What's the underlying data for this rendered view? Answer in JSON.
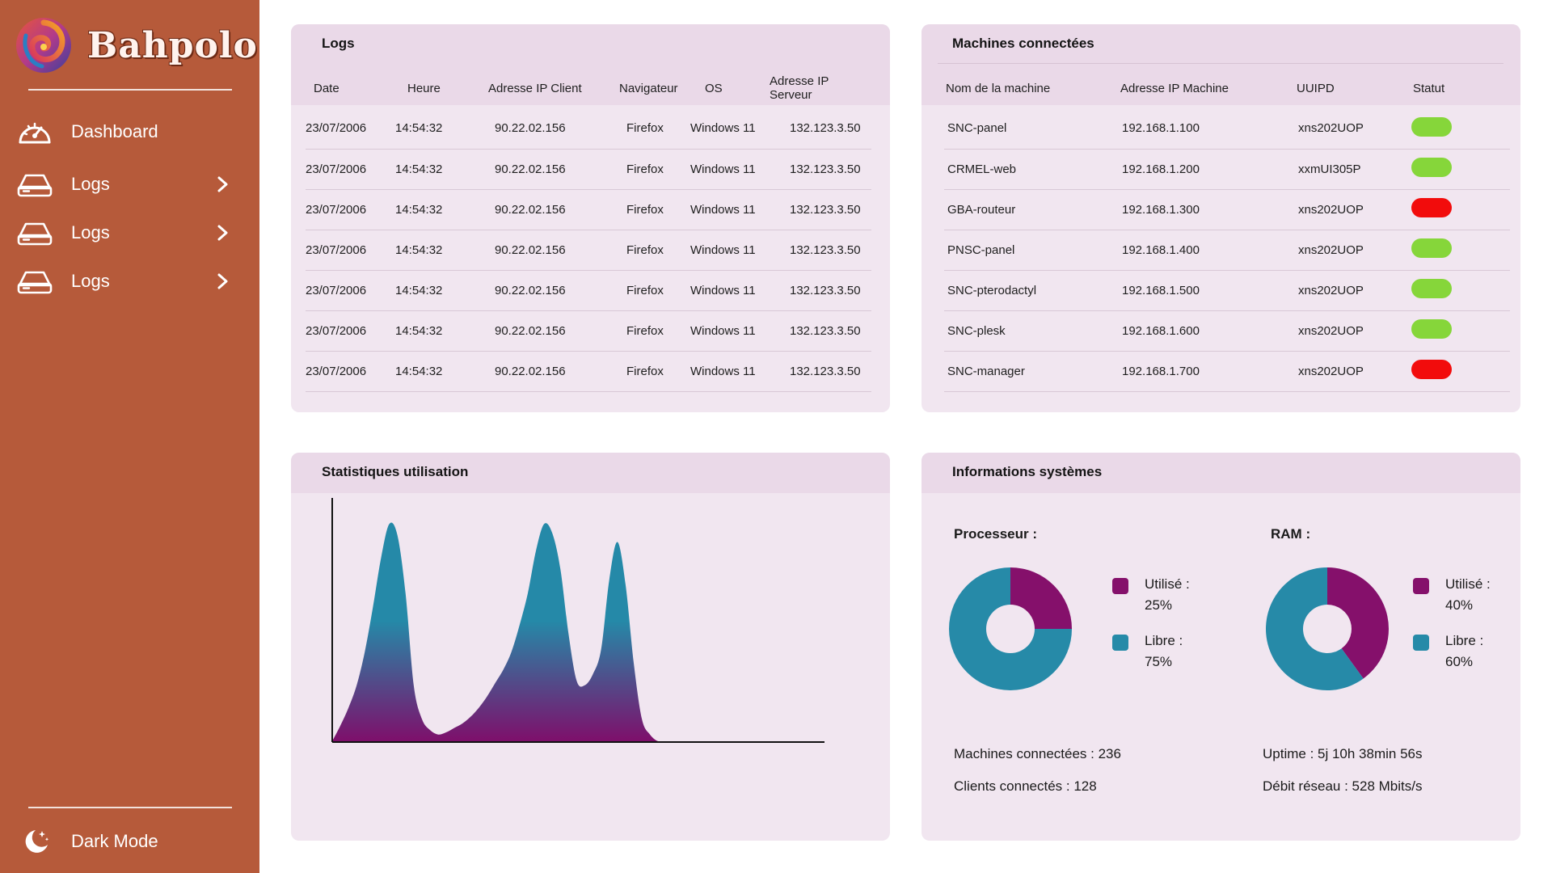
{
  "brand": {
    "name": "Bahpolo"
  },
  "nav": {
    "items": [
      {
        "label": "Dashboard",
        "icon": "speedometer-icon"
      },
      {
        "label": "Logs",
        "icon": "server-icon"
      },
      {
        "label": "Logs",
        "icon": "server-icon"
      },
      {
        "label": "Logs",
        "icon": "server-icon"
      }
    ],
    "dark_mode_label": "Dark Mode"
  },
  "logs": {
    "title": "Logs",
    "columns": [
      "Date",
      "Heure",
      "Adresse IP Client",
      "Navigateur",
      "OS",
      "Adresse IP Serveur"
    ],
    "rows": [
      [
        "23/07/2006",
        "14:54:32",
        "90.22.02.156",
        "Firefox",
        "Windows 11",
        "132.123.3.50"
      ],
      [
        "23/07/2006",
        "14:54:32",
        "90.22.02.156",
        "Firefox",
        "Windows 11",
        "132.123.3.50"
      ],
      [
        "23/07/2006",
        "14:54:32",
        "90.22.02.156",
        "Firefox",
        "Windows 11",
        "132.123.3.50"
      ],
      [
        "23/07/2006",
        "14:54:32",
        "90.22.02.156",
        "Firefox",
        "Windows 11",
        "132.123.3.50"
      ],
      [
        "23/07/2006",
        "14:54:32",
        "90.22.02.156",
        "Firefox",
        "Windows 11",
        "132.123.3.50"
      ],
      [
        "23/07/2006",
        "14:54:32",
        "90.22.02.156",
        "Firefox",
        "Windows 11",
        "132.123.3.50"
      ],
      [
        "23/07/2006",
        "14:54:32",
        "90.22.02.156",
        "Firefox",
        "Windows 11",
        "132.123.3.50"
      ]
    ]
  },
  "machines": {
    "title": "Machines connectées",
    "columns": [
      "Nom de la machine",
      "Adresse IP Machine",
      "UUIPD",
      "Statut"
    ],
    "rows": [
      {
        "name": "SNC-panel",
        "ip": "192.168.1.100",
        "uuid": "xns202UOP",
        "status": "online"
      },
      {
        "name": "CRMEL-web",
        "ip": "192.168.1.200",
        "uuid": "xxmUI305P",
        "status": "online"
      },
      {
        "name": "GBA-routeur",
        "ip": "192.168.1.300",
        "uuid": "xns202UOP",
        "status": "offline"
      },
      {
        "name": "PNSC-panel",
        "ip": "192.168.1.400",
        "uuid": "xns202UOP",
        "status": "online"
      },
      {
        "name": "SNC-pterodactyl",
        "ip": "192.168.1.500",
        "uuid": "xns202UOP",
        "status": "online"
      },
      {
        "name": "SNC-plesk",
        "ip": "192.168.1.600",
        "uuid": "xns202UOP",
        "status": "online"
      },
      {
        "name": "SNC-manager",
        "ip": "192.168.1.700",
        "uuid": "xns202UOP",
        "status": "offline"
      }
    ],
    "status_colors": {
      "online": "#86d63a",
      "offline": "#f20c0c"
    }
  },
  "stats": {
    "title": "Statistiques utilisation"
  },
  "chart_data": {
    "type": "area",
    "x": [
      0,
      2,
      4,
      6,
      8,
      10,
      12,
      14,
      16,
      18,
      20,
      22,
      24,
      26,
      28,
      30,
      32,
      34,
      36,
      38,
      40,
      42,
      44,
      46,
      48,
      50,
      52,
      54,
      56,
      58,
      60,
      62,
      64,
      66,
      68,
      70,
      72,
      74,
      76,
      78,
      80,
      82,
      84,
      86,
      88,
      90,
      92,
      94,
      96,
      98,
      100
    ],
    "values": [
      0,
      7,
      15,
      25,
      40,
      60,
      82,
      97,
      92,
      66,
      25,
      10,
      5,
      3,
      4,
      6,
      8,
      11,
      15,
      20,
      26,
      32,
      40,
      52,
      66,
      85,
      97,
      93,
      77,
      48,
      27,
      25,
      30,
      41,
      72,
      89,
      70,
      35,
      10,
      3,
      0,
      0,
      0,
      0,
      0,
      0,
      0,
      0,
      0,
      0,
      0
    ],
    "xlabel": "",
    "ylabel": "",
    "ylim": [
      0,
      100
    ],
    "grid": false,
    "gradient": {
      "top": "#2589a8",
      "bottom": "#7e0f6b"
    }
  },
  "system": {
    "title": "Informations systèmes",
    "cpu": {
      "label": "Processeur :",
      "used_label": "Utilisé :",
      "used_value": "25%",
      "free_label": "Libre :",
      "free_value": "75%",
      "used_fraction": 0.25
    },
    "ram": {
      "label": "RAM :",
      "used_label": "Utilisé :",
      "used_value": "40%",
      "free_label": "Libre :",
      "free_value": "60%",
      "used_fraction": 0.4
    },
    "colors": {
      "used": "#85106b",
      "free": "#268aa8"
    },
    "machines_connected": "Machines connectées : 236",
    "clients_connected": "Clients connectés : 128",
    "uptime": "Uptime : 5j 10h 38min 56s",
    "network": "Débit réseau : 528 Mbits/s"
  }
}
